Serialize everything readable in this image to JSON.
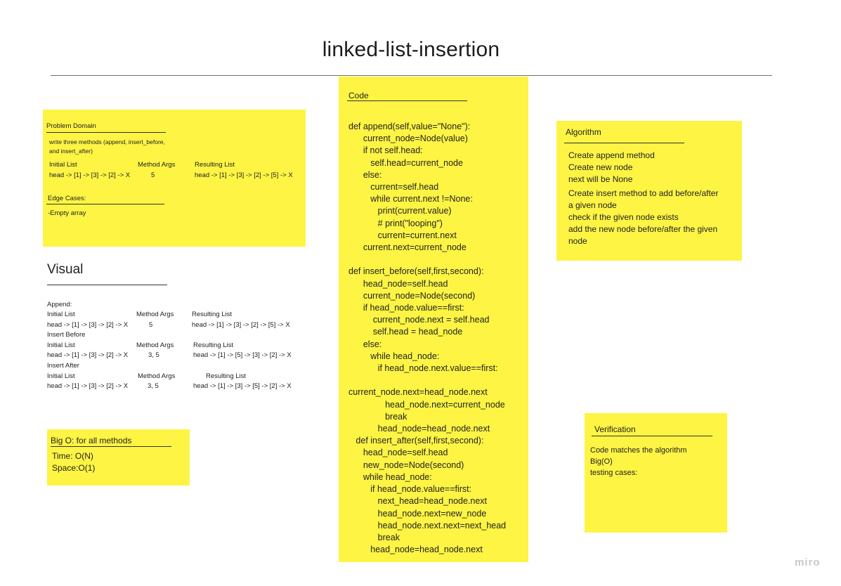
{
  "board": {
    "title": "linked-list-insertion",
    "watermark": "miro"
  },
  "problem_domain": {
    "title": "Problem Domain",
    "description_1": "write three methods (append, insert_before,",
    "description_2": "and insert_after)",
    "col_initial": "Initial List",
    "col_args": "Method Args",
    "col_result": "Resulting List",
    "row_initial": "head -> [1] -> [3] -> [2] -> X",
    "row_args": "5",
    "row_result": "head -> [1] -> [3] -> [2] -> [5] -> X",
    "edge_title": "Edge Cases:",
    "edge_item": "-Empty array"
  },
  "visual": {
    "title": "Visual",
    "append_label": "Append:",
    "insert_before_label": "Insert Before",
    "insert_after_label": "Insert After",
    "col_initial": "Initial List",
    "col_args": "Method Args",
    "col_result": "Resulting List",
    "append_initial": "head -> [1] -> [3] -> [2] -> X",
    "append_args": "5",
    "append_result": "head -> [1] -> [3] -> [2] -> [5] -> X",
    "before_initial": "head -> [1] -> [3] -> [2] -> X",
    "before_args": "3, 5",
    "before_result": "head -> [1] -> [5] -> [3] -> [2] -> X",
    "after_initial": "head -> [1] -> [3] -> [2] -> X",
    "after_args": "3, 5",
    "after_result": "head -> [1] -> [3] -> [5] -> [2] -> X"
  },
  "big_o": {
    "title": "Big O: for all methods",
    "time": "Time: O(N)",
    "space": "Space:O(1)"
  },
  "code": {
    "title": "Code",
    "lines": [
      "def append(self,value=\"None\"):",
      "      current_node=Node(value)",
      "      if not self.head:",
      "         self.head=current_node",
      "      else:",
      "         current=self.head",
      "         while current.next !=None:",
      "            print(current.value)",
      "            # print(\"looping\")",
      "            current=current.next",
      "      current.next=current_node",
      "",
      "def insert_before(self,first,second):",
      "      head_node=self.head",
      "      current_node=Node(second)",
      "      if head_node.value==first:",
      "          current_node.next = self.head",
      "          self.head = head_node",
      "      else:",
      "         while head_node:",
      "            if head_node.next.value==first:",
      "",
      "current_node.next=head_node.next",
      "               head_node.next=current_node",
      "               break",
      "            head_node=head_node.next",
      "   def insert_after(self,first,second):",
      "      head_node=self.head",
      "      new_node=Node(second)",
      "      while head_node:",
      "         if head_node.value==first:",
      "            next_head=head_node.next",
      "            head_node.next=new_node",
      "            head_node.next.next=next_head",
      "            break",
      "         head_node=head_node.next"
    ]
  },
  "algorithm": {
    "title": "Algorithm",
    "lines_a": [
      "Create append method",
      "Create new node",
      "next will be None"
    ],
    "lines_b": [
      "Create insert method to add before/after",
      "a given node",
      "check if the given node exists",
      "add the new node before/after the given",
      "node"
    ]
  },
  "verification": {
    "title": "Verification",
    "lines": [
      "Code matches the algorithm",
      "Big(O)",
      "testing cases:"
    ]
  }
}
